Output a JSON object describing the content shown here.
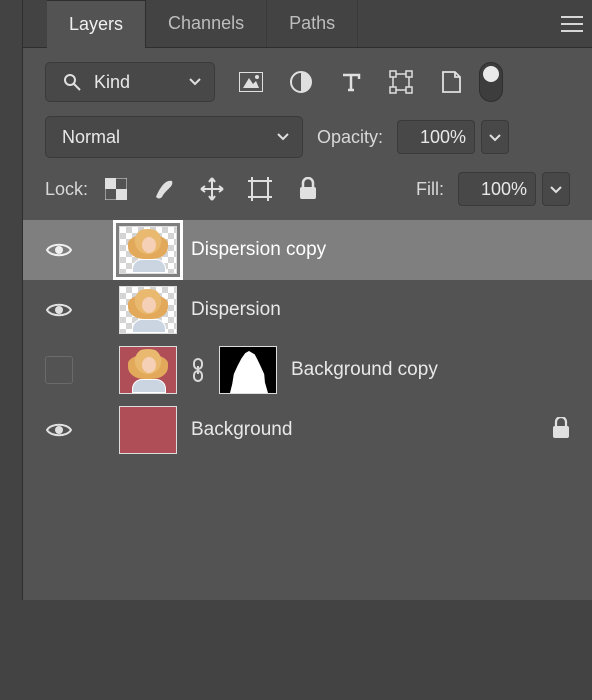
{
  "tabs": {
    "layers": "Layers",
    "channels": "Channels",
    "paths": "Paths"
  },
  "filter": {
    "kind_label": "Kind"
  },
  "blend": {
    "mode": "Normal",
    "opacity_label": "Opacity:",
    "opacity_value": "100%"
  },
  "lock": {
    "label": "Lock:",
    "fill_label": "Fill:",
    "fill_value": "100%"
  },
  "layers": [
    {
      "name": "Dispersion copy",
      "visible": true,
      "selected": true,
      "type": "transparent-person"
    },
    {
      "name": "Dispersion",
      "visible": true,
      "selected": false,
      "type": "transparent-person"
    },
    {
      "name": "Background copy",
      "visible": false,
      "selected": false,
      "type": "red-person-mask"
    },
    {
      "name": "Background",
      "visible": true,
      "selected": false,
      "type": "red",
      "locked": true
    }
  ]
}
